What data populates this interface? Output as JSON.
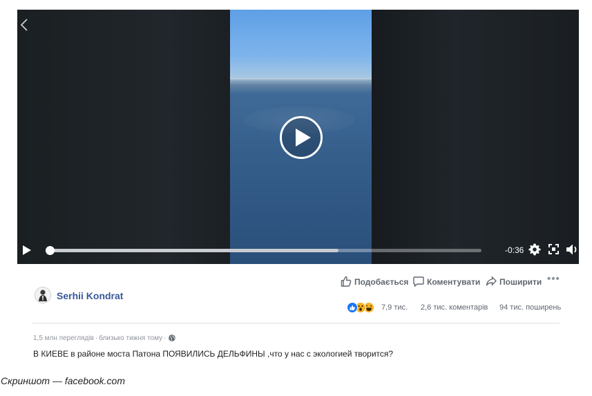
{
  "video": {
    "time_remaining": "-0:36",
    "progress": 0.67,
    "icons": {
      "back": "chevron-left-icon",
      "play_big": "play-circle-icon",
      "play": "play-icon",
      "settings": "gear-icon",
      "fullscreen": "fullscreen-icon",
      "volume": "volume-icon"
    }
  },
  "post": {
    "author": "Serhii Kondrat",
    "actions": {
      "like": "Подобається",
      "comment": "Коментувати",
      "share": "Поширити",
      "more": "•••"
    },
    "stats": {
      "reactions_count": "7,9 тис.",
      "comments": "2,6 тис. коментарів",
      "shares": "94 тис. поширень"
    },
    "reactions": [
      "like",
      "wow",
      "haha"
    ],
    "meta": {
      "views": "1,5 млн переглядів",
      "time": "близько тижня тому"
    },
    "text": "В КИЕВЕ в районе моста Патона ПОЯВИЛИСЬ ДЕЛЬФИНЫ ,что у нас с экологией творится?"
  },
  "caption": "Скриншот — facebook.com",
  "colors": {
    "link": "#385898",
    "like": "#1877f2",
    "wow": "#f7b125"
  }
}
